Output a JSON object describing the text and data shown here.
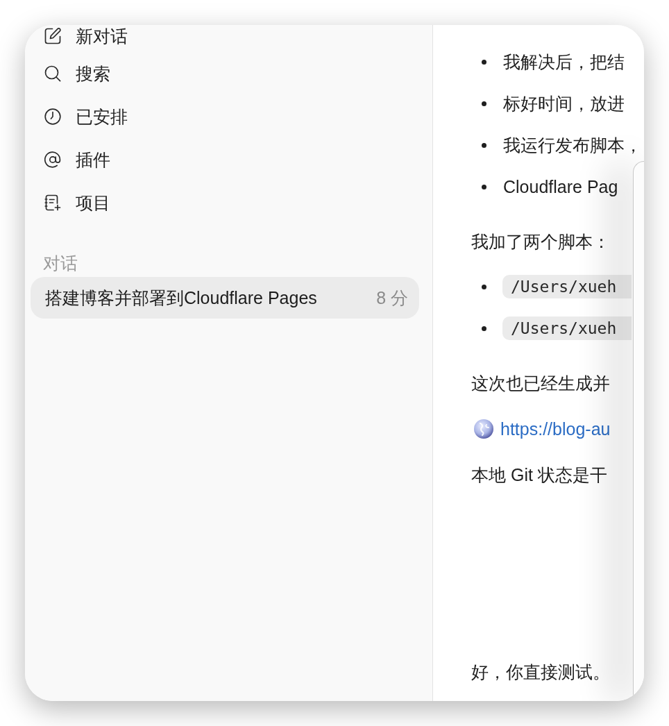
{
  "sidebar": {
    "nav": [
      "新对话",
      "搜索",
      "已安排",
      "插件",
      "项目"
    ],
    "section_label": "对话",
    "conversations": [
      {
        "title": "搭建博客并部署到Cloudflare Pages",
        "time": "8 分",
        "selected": true
      }
    ]
  },
  "conversation": {
    "blocks": [
      {
        "kind": "bullet_list",
        "items": [
          "我解决后，把结",
          "标好时间，放进",
          "我运行发布脚本，",
          "Cloudflare Pag"
        ]
      },
      {
        "kind": "paragraph",
        "text": "我加了两个脚本："
      },
      {
        "kind": "code_list",
        "items": [
          "/Users/xueh",
          "/Users/xueh"
        ]
      },
      {
        "kind": "paragraph",
        "text": "这次也已经生成并"
      },
      {
        "kind": "link",
        "text": "https://blog-au"
      },
      {
        "kind": "paragraph",
        "text": "本地 Git 状态是干"
      }
    ],
    "user_message": "好，你直接测试。"
  }
}
